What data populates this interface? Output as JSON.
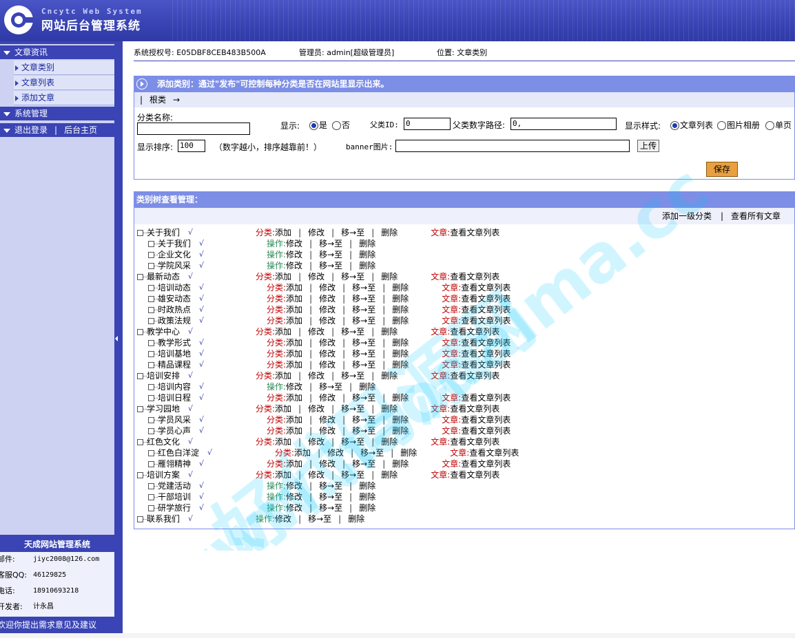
{
  "header": {
    "brand_en": "Cncytc Web System",
    "brand_cn": "网站后台管理系统"
  },
  "sidebar": {
    "sections": [
      {
        "label": "文章资讯",
        "items": [
          "文章类别",
          "文章列表",
          "添加文章"
        ]
      },
      {
        "label": "系统管理"
      }
    ],
    "logout_label": "退出登录",
    "home_label": "后台主页",
    "info_title": "天成网站管理系统",
    "info": [
      {
        "label": "邮件:",
        "value": "jiyc2008@126.com"
      },
      {
        "label": "客服QQ:",
        "value": "46129825"
      },
      {
        "label": "电话:",
        "value": "18910693218"
      },
      {
        "label": "开发者:",
        "value": "计永昌"
      }
    ],
    "footer_text": "欢迎你提出需求意见及建议"
  },
  "topbar": {
    "license": "系统授权号: E05DBF8CEB483B500A",
    "admin": "管理员: admin[超级管理员]",
    "location": "位置: 文章类别"
  },
  "add_panel": {
    "title": "添加类别：通过\"发布\"可控制每种分类是否在网站里显示出来。",
    "crumb_sep": "|",
    "crumb_root": "根类",
    "crumb_arrow": "→",
    "name_label": "分类名称:",
    "name_value": "",
    "show_label": "显示:",
    "show_yes": "是",
    "show_no": "否",
    "parent_id_label": "父类ID:",
    "parent_id_value": "0",
    "parent_path_label": "父类数字路径:",
    "parent_path_value": "0,",
    "style_label": "显示样式:",
    "style_options": [
      "文章列表",
      "图片相册",
      "单页"
    ],
    "order_label": "显示排序:",
    "order_value": "100",
    "order_hint": "（数字越小，排序越靠前！）",
    "banner_label": "banner图片:",
    "banner_value": "",
    "upload_label": "上传",
    "save_label": "保存"
  },
  "tree_panel": {
    "title": "类别树查看管理：",
    "add_top_label": "添加一级分类",
    "tools_sep": "|",
    "view_all_label": "查看所有文章",
    "labels": {
      "cat": "分类:",
      "op": "操作:",
      "art": "文章:",
      "add": "添加",
      "edit": "修改",
      "move": "移→至",
      "delete": "删除",
      "view": "查看文章列表",
      "sep": "|",
      "check": "√"
    },
    "rows": [
      {
        "level": 0,
        "name": "关于我们",
        "kind": "cat",
        "articles": true
      },
      {
        "level": 1,
        "name": "关于我们",
        "kind": "op",
        "articles": false
      },
      {
        "level": 1,
        "name": "企业文化",
        "kind": "op",
        "articles": false
      },
      {
        "level": 1,
        "name": "学院风采",
        "kind": "op",
        "articles": false
      },
      {
        "level": 0,
        "name": "最新动态",
        "kind": "cat",
        "articles": true
      },
      {
        "level": 1,
        "name": "培训动态",
        "kind": "cat",
        "articles": true
      },
      {
        "level": 1,
        "name": "雄安动态",
        "kind": "cat",
        "articles": true
      },
      {
        "level": 1,
        "name": "时政热点",
        "kind": "cat",
        "articles": true
      },
      {
        "level": 1,
        "name": "政策法规",
        "kind": "cat",
        "articles": true
      },
      {
        "level": 0,
        "name": "教学中心",
        "kind": "cat",
        "articles": true
      },
      {
        "level": 1,
        "name": "教学形式",
        "kind": "cat",
        "articles": true
      },
      {
        "level": 1,
        "name": "培训基地",
        "kind": "cat",
        "articles": true
      },
      {
        "level": 1,
        "name": "精品课程",
        "kind": "cat",
        "articles": true
      },
      {
        "level": 0,
        "name": "培训安排",
        "kind": "cat",
        "articles": true
      },
      {
        "level": 1,
        "name": "培训内容",
        "kind": "op",
        "articles": false
      },
      {
        "level": 1,
        "name": "培训日程",
        "kind": "cat",
        "articles": true
      },
      {
        "level": 0,
        "name": "学习园地",
        "kind": "cat",
        "articles": true
      },
      {
        "level": 1,
        "name": "学员风采",
        "kind": "cat",
        "articles": true
      },
      {
        "level": 1,
        "name": "学员心声",
        "kind": "cat",
        "articles": true
      },
      {
        "level": 0,
        "name": "红色文化",
        "kind": "cat",
        "articles": true
      },
      {
        "level": 1,
        "name": "红色白洋淀",
        "kind": "cat",
        "articles": true
      },
      {
        "level": 1,
        "name": "雁翎精神",
        "kind": "cat",
        "articles": true
      },
      {
        "level": 0,
        "name": "培训方案",
        "kind": "cat",
        "articles": true
      },
      {
        "level": 1,
        "name": "党建活动",
        "kind": "op",
        "articles": false
      },
      {
        "level": 1,
        "name": "干部培训",
        "kind": "op",
        "articles": false
      },
      {
        "level": 1,
        "name": "研学旅行",
        "kind": "op",
        "articles": false
      },
      {
        "level": 0,
        "name": "联系我们",
        "kind": "op",
        "articles": false
      }
    ]
  },
  "watermark": {
    "text_1": "好代码源网",
    "text_2": "www.haodaima.cc"
  },
  "colors": {
    "primary_blue": "#3a44b4",
    "panel_head": "#7d8ee6",
    "cat_red": "#c00000",
    "op_green": "#2e8b57",
    "save_orange": "#e8a040"
  }
}
